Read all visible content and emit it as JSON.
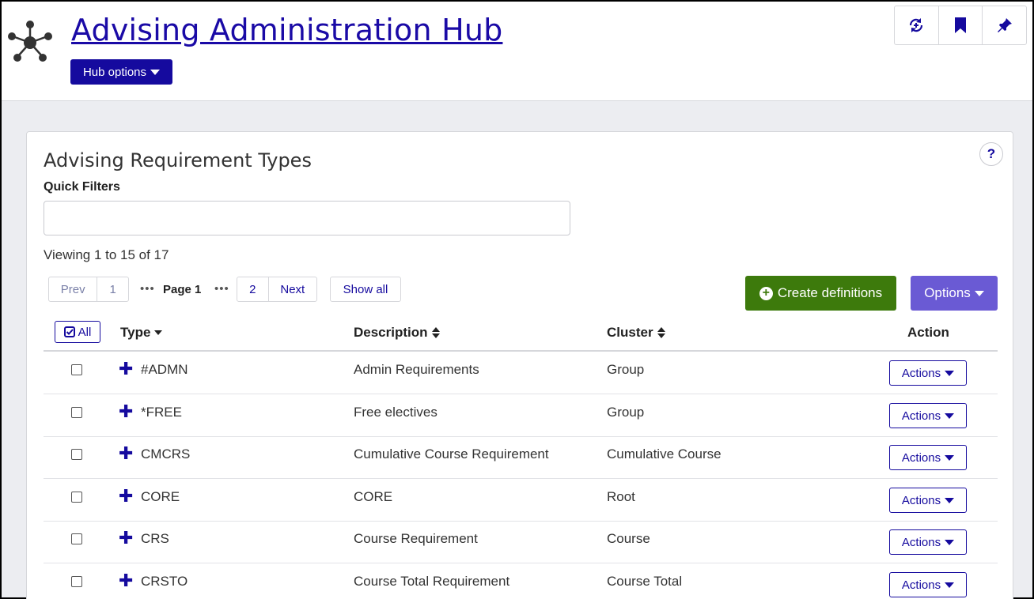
{
  "header": {
    "title": "Advising Administration Hub",
    "hub_options_label": "Hub options",
    "tools": [
      "sync-icon",
      "bookmark-icon",
      "pin-icon"
    ]
  },
  "card": {
    "title": "Advising Requirement Types",
    "help_label": "?",
    "quick_filters_label": "Quick Filters",
    "quick_filters_value": "",
    "viewing_text": "Viewing 1 to 15 of 17"
  },
  "pager": {
    "prev": "Prev",
    "first": "1",
    "dots": "•••",
    "current": "Page 1",
    "next_page": "2",
    "next": "Next",
    "show_all": "Show all"
  },
  "toolbar": {
    "create_label": "Create definitions",
    "options_label": "Options"
  },
  "table": {
    "all_label": "All",
    "columns": [
      "Type",
      "Description",
      "Cluster",
      "Action"
    ],
    "rows": [
      {
        "type": "#ADMN",
        "description": "Admin Requirements",
        "cluster": "Group",
        "action": "Actions"
      },
      {
        "type": "*FREE",
        "description": "Free electives",
        "cluster": "Group",
        "action": "Actions"
      },
      {
        "type": "CMCRS",
        "description": "Cumulative Course Requirement",
        "cluster": "Cumulative Course",
        "action": "Actions"
      },
      {
        "type": "CORE",
        "description": "CORE",
        "cluster": "Root",
        "action": "Actions"
      },
      {
        "type": "CRS",
        "description": "Course Requirement",
        "cluster": "Course",
        "action": "Actions"
      },
      {
        "type": "CRSTO",
        "description": "Course Total Requirement",
        "cluster": "Course Total",
        "action": "Actions"
      }
    ]
  },
  "colors": {
    "brand": "#150a9e",
    "create": "#3d7a0c",
    "options": "#6a5ad4",
    "page_bg": "#ecedf1"
  }
}
